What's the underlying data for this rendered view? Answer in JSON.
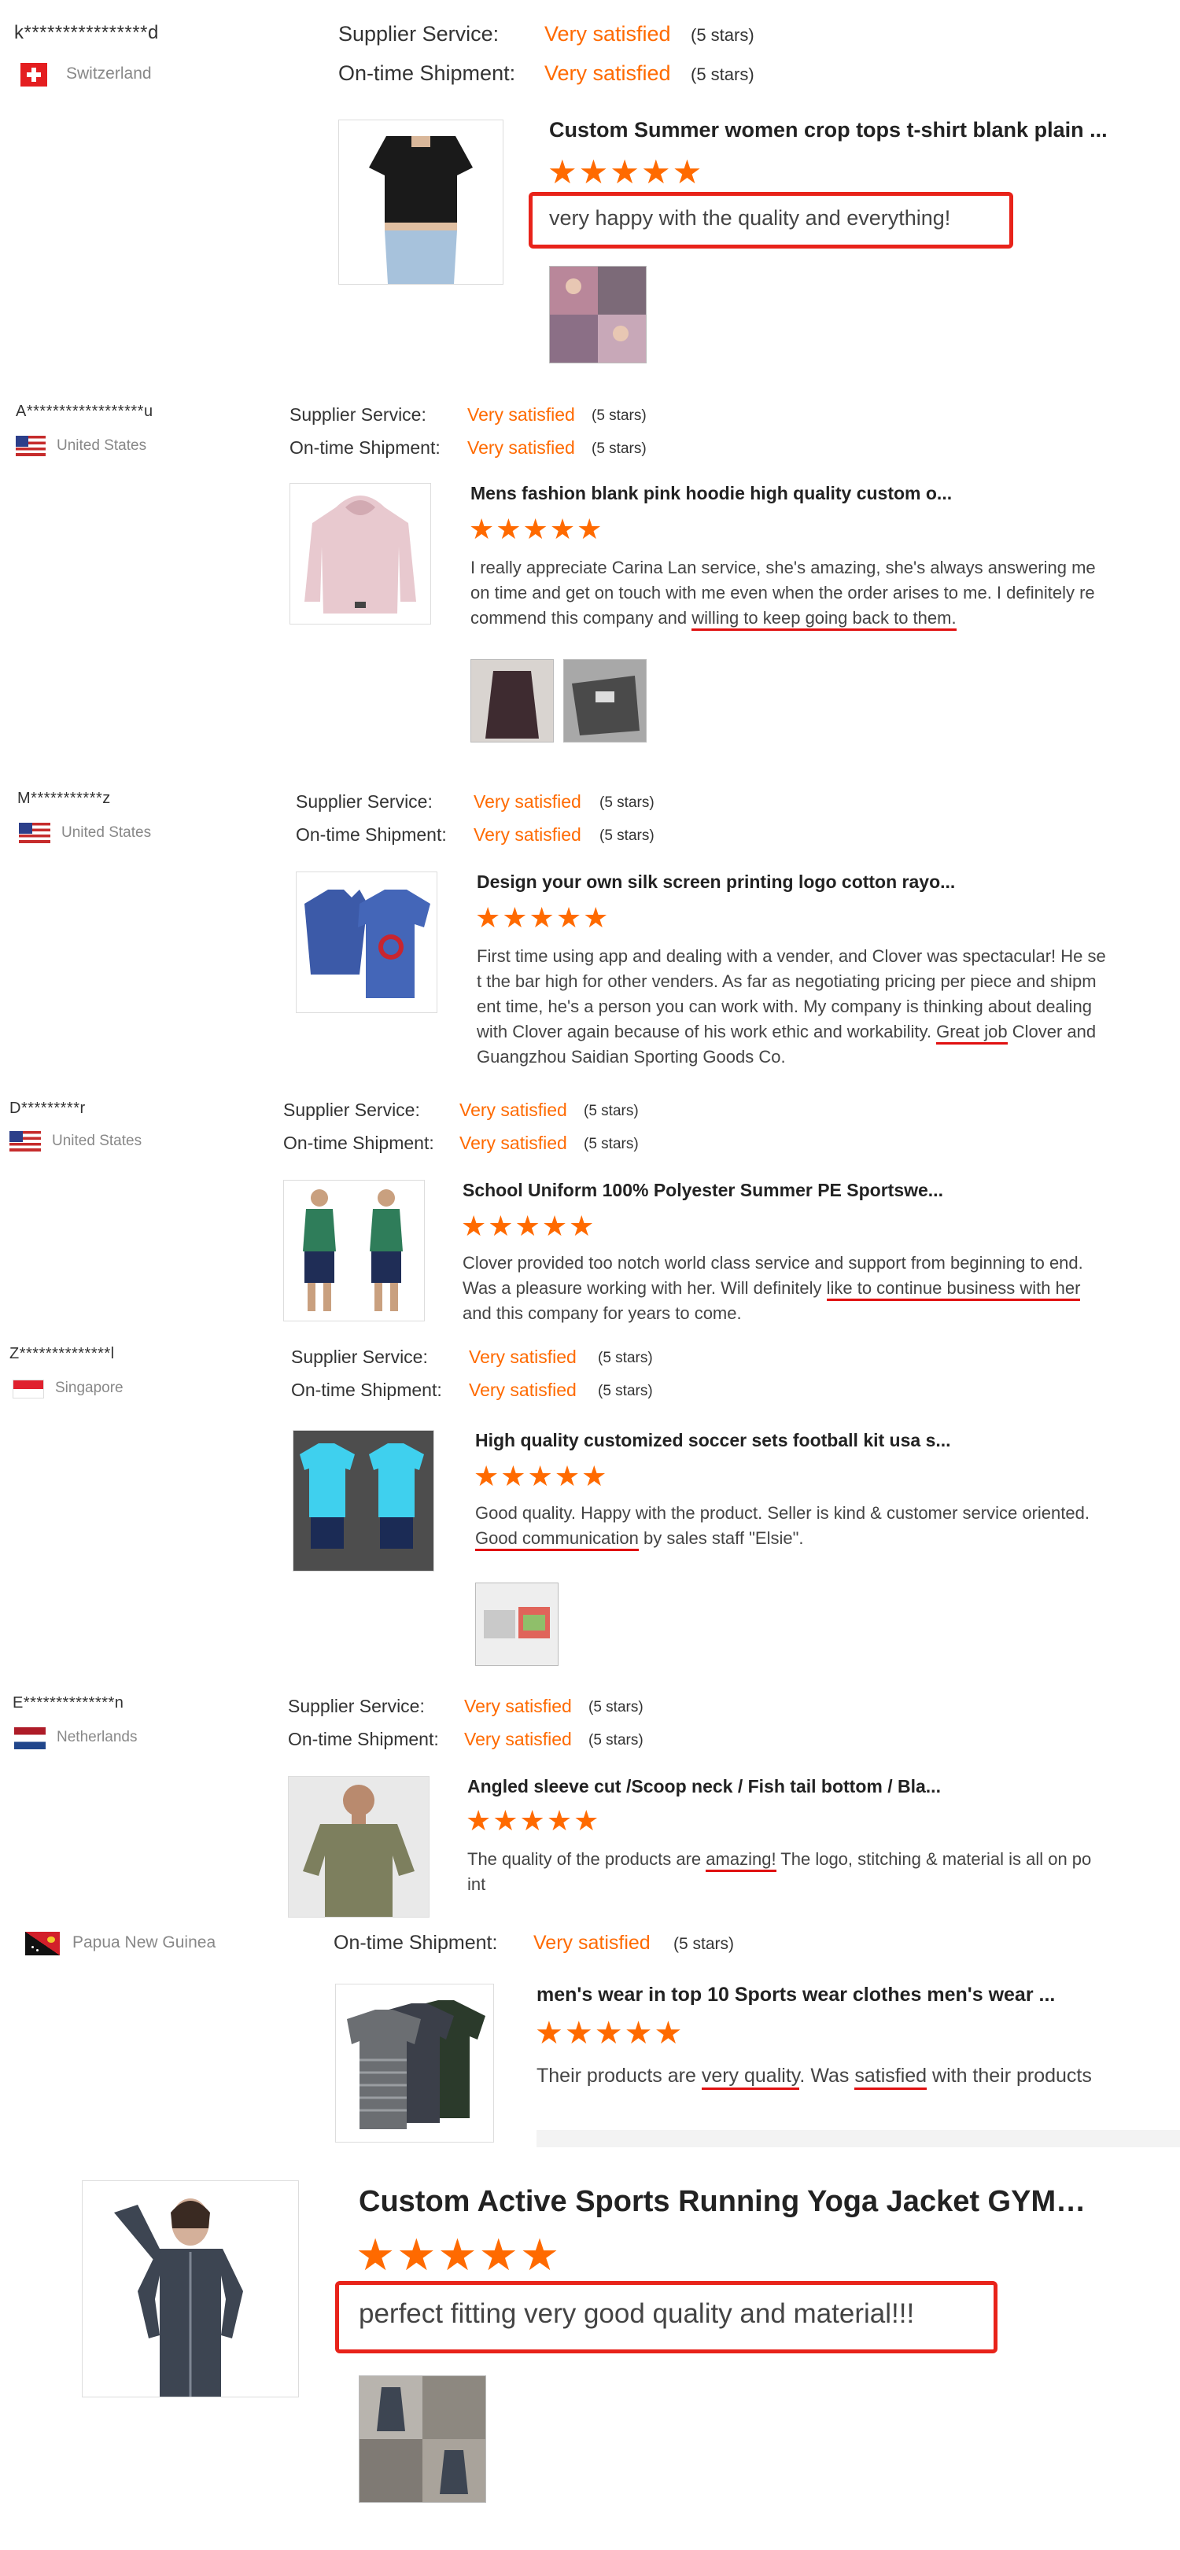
{
  "labels": {
    "supplier_service": "Supplier Service:",
    "on_time_shipment": "On-time Shipment:",
    "very_satisfied": "Very satisfied",
    "five_stars": "(5 stars)",
    "stars_glyphs": "★★★★★"
  },
  "colors": {
    "accent": "#ff6a00",
    "highlight": "#e8231a"
  },
  "reviews": [
    {
      "name": "k****************d",
      "country": "Switzerland",
      "flag_icon": "switzerland-flag-icon",
      "product": "Custom Summer women crop tops t-shirt blank plain ...",
      "rating": 5,
      "comment": "very happy with the quality and everything!",
      "photos": 1
    },
    {
      "name": "A******************u",
      "country": "United States",
      "flag_icon": "united-states-flag-icon",
      "product": "Mens fashion blank pink hoodie high quality custom o...",
      "rating": 5,
      "comment_lines": [
        "I really appreciate Carina Lan service, she's amazing, she's always answering me",
        "on time and get on touch with me even when the order arises to me. I definitely re",
        "commend this company and ",
        "willing to keep going back to them."
      ],
      "photos": 2
    },
    {
      "name": "M***********z",
      "country": "United States",
      "flag_icon": "united-states-flag-icon",
      "product": "Design your own silk screen printing logo cotton rayo...",
      "rating": 5,
      "comment_lines": [
        "First time using app and dealing with a vender, and Clover was spectacular! He se",
        "t the bar high for other venders. As far as negotiating pricing per piece and shipm",
        "ent time, he's a person you can work with. My company is thinking about dealing",
        "with Clover again because of his work ethic and workability. ",
        "Great job",
        " Clover and",
        "Guangzhou Saidian Sporting Goods Co."
      ],
      "photos": 0
    },
    {
      "name": "D*********r",
      "country": "United States",
      "flag_icon": "united-states-flag-icon",
      "product": "School Uniform 100% Polyester Summer PE Sportswe...",
      "rating": 5,
      "comment_lines": [
        "Clover provided too notch world class service and support from beginning to end.",
        "Was a pleasure working with her. Will definitely ",
        "like to continue business with her",
        "and this company for years to come."
      ],
      "photos": 0
    },
    {
      "name": "Z**************l",
      "country": "Singapore",
      "flag_icon": "singapore-flag-icon",
      "product": "High quality customized soccer sets football kit usa s...",
      "rating": 5,
      "comment_lines": [
        "Good quality. Happy with the product. Seller is kind & customer service oriented.",
        "Good communication",
        " by sales staff \"Elsie\"."
      ],
      "photos": 1
    },
    {
      "name": "E**************n",
      "country": "Netherlands",
      "flag_icon": "netherlands-flag-icon",
      "product": "Angled sleeve cut /Scoop neck / Fish tail bottom / Bla...",
      "rating": 5,
      "comment_lines": [
        "The quality of the products are ",
        "amazing!",
        " The logo, stitching & material is all on po",
        "int"
      ],
      "photos": 0
    },
    {
      "country": "Papua New Guinea",
      "flag_icon": "papua-new-guinea-flag-icon",
      "product": "men's wear in top 10 Sports wear clothes men's wear ...",
      "rating": 5,
      "comment_parts": [
        "Their products are ",
        "very quality",
        ". Was ",
        "satisfied",
        " with their products"
      ],
      "photos": 0
    },
    {
      "product": "Custom Active Sports Running Yoga Jacket GYM Fitn...",
      "rating": 5,
      "comment": "perfect fitting very good quality and material!!!",
      "photos": 1
    }
  ]
}
